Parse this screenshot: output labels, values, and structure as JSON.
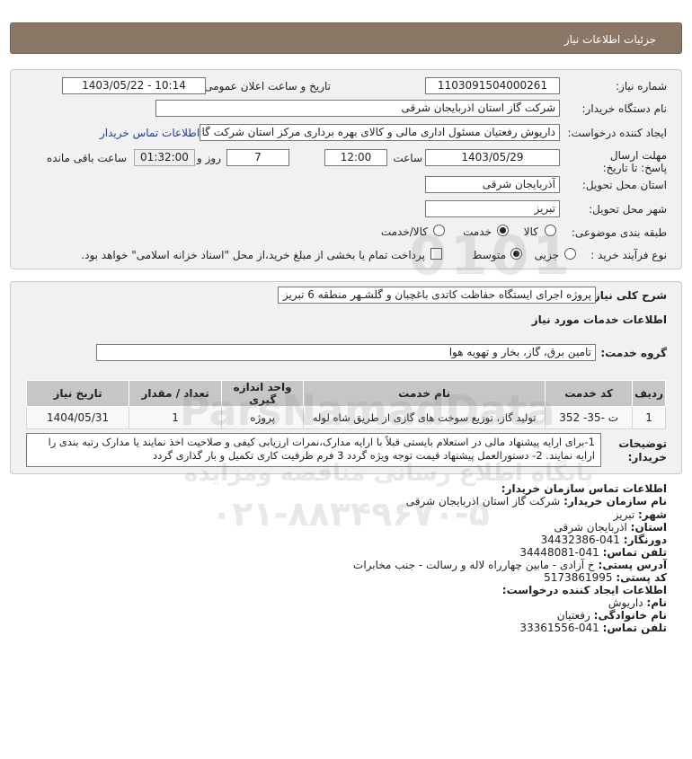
{
  "header": {
    "title": "جزئیات اطلاعات نیاز"
  },
  "form": {
    "need_number_label": "شماره نیاز:",
    "need_number": "1103091504000261",
    "announce_label": "تاریخ و ساعت اعلان عمومی:",
    "announce_value": "1403/05/22 - 10:14",
    "buyer_label": "نام دستگاه خریدار:",
    "buyer_value": "شرکت گاز استان اذربایجان شرقی",
    "creator_label": "ایجاد کننده درخواست:",
    "creator_value": "داریوش   رفعتیان مسئول اداری مالی و کالای بهره برداری مرکز استان شرکت گا",
    "contact_link": "اطلاعات تماس خریدار",
    "deadline_label": "مهلت ارسال پاسخ: تا تاریخ:",
    "deadline_date": "1403/05/29",
    "time_label": "ساعت",
    "deadline_time": "12:00",
    "days_value": "7",
    "days_label": "روز و",
    "remaining_value": "01:32:00",
    "remaining_label": "ساعت باقی مانده",
    "province_label": "استان محل تحویل:",
    "province_value": "آذربایجان شرقی",
    "city_label": "شهر محل تحویل:",
    "city_value": "تبریز",
    "category_label": "طبقه بندی موضوعی:",
    "category_options": [
      "کالا",
      "خدمت",
      "کالا/خدمت"
    ],
    "category_selected": "خدمت",
    "process_label": "نوع فرآیند خرید :",
    "process_options": [
      "جزیی",
      "متوسط"
    ],
    "process_selected": "متوسط",
    "payment_note": "پرداخت تمام یا بخشی از مبلغ خرید،از محل \"اسناد خزانه اسلامی\" خواهد بود."
  },
  "summary": {
    "title_label": "شرح کلی نیاز:",
    "title_value": "پروژه اجرای ایستگاه حفاظت کاتدی باغچبان و گلشـهر منطقه 6 تبریز",
    "services_heading": "اطلاعات خدمات مورد نیاز",
    "group_label": "گروه خدمت:",
    "group_value": "تامین برق، گاز، بخار و تهویه هوا",
    "table": {
      "headers": [
        "ردیف",
        "کد خدمت",
        "نام خدمت",
        "واحد اندازه گیری",
        "تعداد / مقدار",
        "تاریخ نیاز"
      ],
      "rows": [
        [
          "1",
          "ت -35- 352",
          "تولید گاز، توزیع سوخت های گازی از طریق شاه لوله",
          "پروژه",
          "1",
          "1404/05/31"
        ]
      ]
    },
    "notes_label": "توضیحات خریدار:",
    "notes_value": "1-برای ارایه پیشنهاد مالی در استعلام بایستی قبلاً با ارایه مدارک،نمرات ارزیابی کیفی و صلاحیت اخذ نمایند یا مدارک رتبه بندی را ارایه نمایند. 2- دستورالعمل پیشنهاد قیمت توجه ویژه گردد 3 فرم ظرفیت کاری تکمیل و بار گذاری گردد"
  },
  "contact": {
    "heading": "اطلاعات تماس سازمان خریدار:",
    "org_label": "نام سازمان خریدار:",
    "org_value": "شرکت گاز استان اذربایجان شرقی",
    "city_label": "شهر:",
    "city_value": "تبریز",
    "province_label": "استان:",
    "province_value": "اذربایجان شرقی",
    "fax_label": "دورنگار:",
    "fax_value": "041-34432386",
    "phone_label": "تلفن تماس:",
    "phone_value": "041-34448081",
    "address_label": "آدرس پستی:",
    "address_value": "خ آزادی - مابین چهارراه لاله و رسالت - جنب مخابرات",
    "postal_label": "کد پستی:",
    "postal_value": "5173861995",
    "creator_heading": "اطلاعات ایجاد کننده درخواست:",
    "name_label": "نام:",
    "name_value": "داریوش",
    "family_label": "نام خانوادگی:",
    "family_value": "رفعتیان",
    "cphone_label": "تلفن تماس:",
    "cphone_value": "041-33361556"
  },
  "watermark": {
    "big_digits": "0101",
    "site": "ParsNamadData",
    "persian": "پایگاه اطلاع رسانی مناقصه ومزایده",
    "phone": "۰۲۱-۸۸۳۴۹۶۷۰-۵"
  }
}
